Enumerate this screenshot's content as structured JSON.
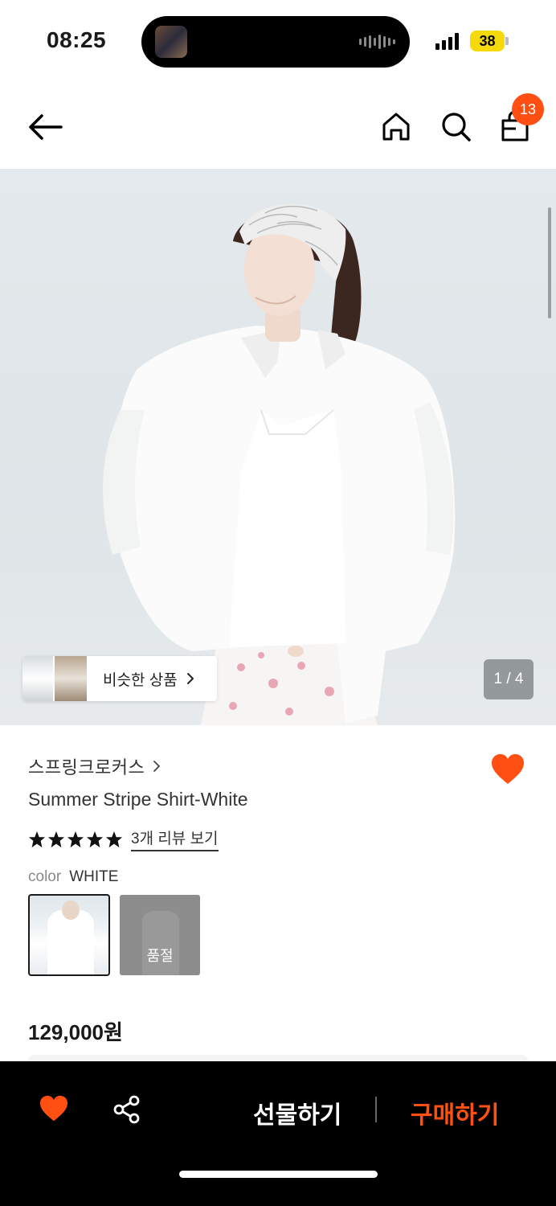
{
  "status_bar": {
    "time": "08:25",
    "battery": "38"
  },
  "nav": {
    "cart_count": "13"
  },
  "gallery": {
    "similar_label": "비슷한 상품",
    "page_indicator": "1 / 4"
  },
  "product": {
    "brand": "스프링크로커스",
    "title": "Summer Stripe Shirt-White",
    "rating": 5,
    "review_link": "3개 리뷰 보기",
    "color_label": "color",
    "color_value": "WHITE",
    "soldout_label": "품절",
    "price": "129,000원"
  },
  "actions": {
    "gift_label": "선물하기",
    "buy_label": "구매하기"
  },
  "colors": {
    "accent": "#ff4f12",
    "badge": "#ff4f12",
    "bar_bg": "#000000"
  },
  "icons": {
    "back": "arrow-left-icon",
    "home": "home-icon",
    "search": "search-icon",
    "cart": "shopping-bag-icon",
    "wish": "heart-icon",
    "share": "share-icon"
  }
}
